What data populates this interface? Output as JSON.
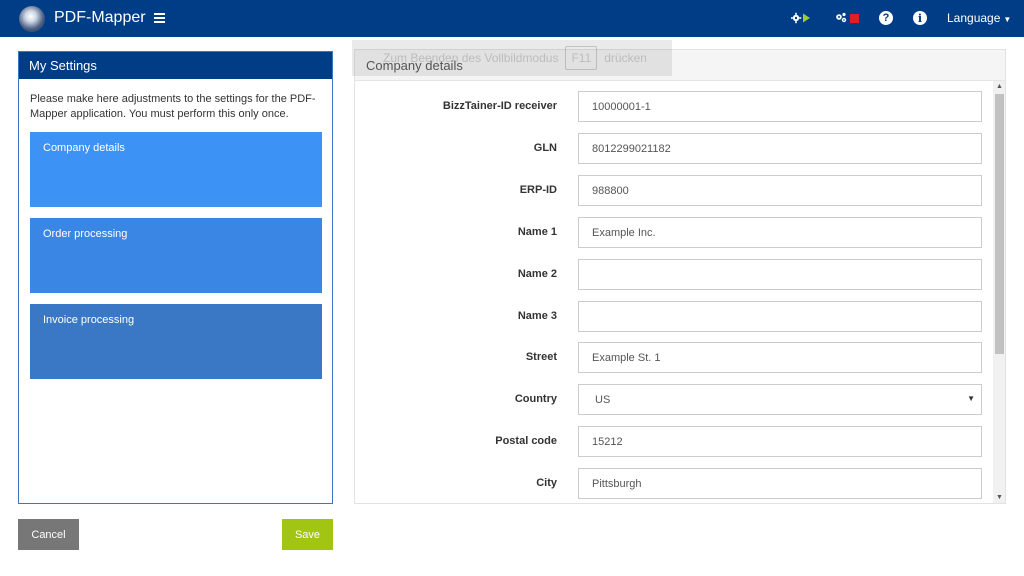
{
  "topbar": {
    "app_title": "PDF-Mapper",
    "icons": [
      "gear-play-icon",
      "gears-stop-icon",
      "help-icon",
      "info-icon"
    ],
    "help_glyph": "?",
    "info_glyph": "i",
    "language_label": "Language",
    "colors": {
      "bar": "#003d87",
      "play": "#9acd32",
      "stop": "#e02020"
    }
  },
  "fullscreen_hint": {
    "before": "Zum Beenden des Vollbildmodus",
    "key": "F11",
    "after": "drücken"
  },
  "left_panel": {
    "title": "My Settings",
    "intro": "Please make here adjustments to the settings for the PDF-Mapper application. You must perform this only once.",
    "cards": [
      {
        "label": "Company details"
      },
      {
        "label": "Order processing"
      },
      {
        "label": "Invoice processing"
      }
    ]
  },
  "buttons": {
    "cancel": "Cancel",
    "save": "Save"
  },
  "right_panel": {
    "title": "Company details",
    "fields": [
      {
        "label": "BizzTainer-ID receiver",
        "value": "10000001-1"
      },
      {
        "label": "GLN",
        "value": "8012299021182"
      },
      {
        "label": "ERP-ID",
        "value": "988800"
      },
      {
        "label": "Name 1",
        "value": "Example Inc."
      },
      {
        "label": "Name 2",
        "value": ""
      },
      {
        "label": "Name 3",
        "value": ""
      },
      {
        "label": "Street",
        "value": "Example St. 1"
      },
      {
        "label": "Country",
        "value": "US"
      },
      {
        "label": "Postal code",
        "value": "15212"
      },
      {
        "label": "City",
        "value": "Pittsburgh"
      }
    ]
  }
}
